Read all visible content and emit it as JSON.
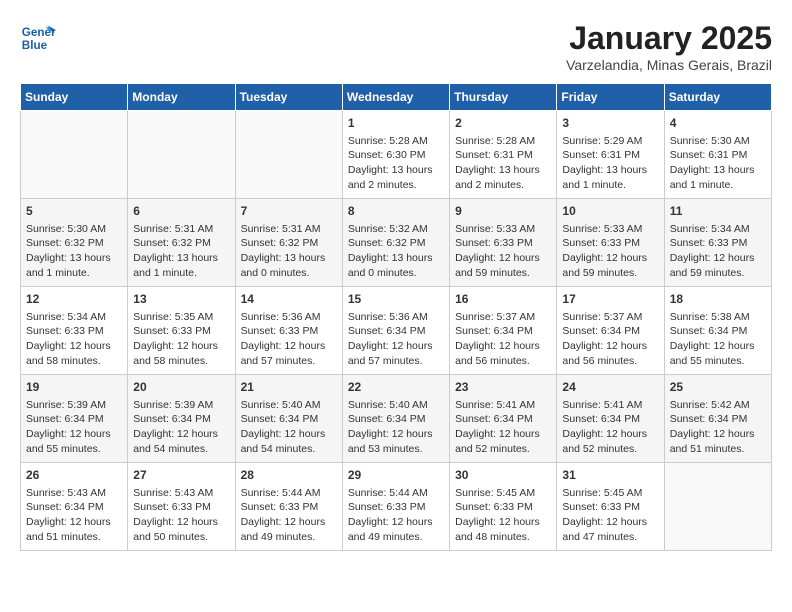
{
  "header": {
    "logo_line1": "General",
    "logo_line2": "Blue",
    "title": "January 2025",
    "subtitle": "Varzelandia, Minas Gerais, Brazil"
  },
  "calendar": {
    "days_of_week": [
      "Sunday",
      "Monday",
      "Tuesday",
      "Wednesday",
      "Thursday",
      "Friday",
      "Saturday"
    ],
    "weeks": [
      [
        {
          "day": "",
          "content": ""
        },
        {
          "day": "",
          "content": ""
        },
        {
          "day": "",
          "content": ""
        },
        {
          "day": "1",
          "content": "Sunrise: 5:28 AM\nSunset: 6:30 PM\nDaylight: 13 hours and 2 minutes."
        },
        {
          "day": "2",
          "content": "Sunrise: 5:28 AM\nSunset: 6:31 PM\nDaylight: 13 hours and 2 minutes."
        },
        {
          "day": "3",
          "content": "Sunrise: 5:29 AM\nSunset: 6:31 PM\nDaylight: 13 hours and 1 minute."
        },
        {
          "day": "4",
          "content": "Sunrise: 5:30 AM\nSunset: 6:31 PM\nDaylight: 13 hours and 1 minute."
        }
      ],
      [
        {
          "day": "5",
          "content": "Sunrise: 5:30 AM\nSunset: 6:32 PM\nDaylight: 13 hours and 1 minute."
        },
        {
          "day": "6",
          "content": "Sunrise: 5:31 AM\nSunset: 6:32 PM\nDaylight: 13 hours and 1 minute."
        },
        {
          "day": "7",
          "content": "Sunrise: 5:31 AM\nSunset: 6:32 PM\nDaylight: 13 hours and 0 minutes."
        },
        {
          "day": "8",
          "content": "Sunrise: 5:32 AM\nSunset: 6:32 PM\nDaylight: 13 hours and 0 minutes."
        },
        {
          "day": "9",
          "content": "Sunrise: 5:33 AM\nSunset: 6:33 PM\nDaylight: 12 hours and 59 minutes."
        },
        {
          "day": "10",
          "content": "Sunrise: 5:33 AM\nSunset: 6:33 PM\nDaylight: 12 hours and 59 minutes."
        },
        {
          "day": "11",
          "content": "Sunrise: 5:34 AM\nSunset: 6:33 PM\nDaylight: 12 hours and 59 minutes."
        }
      ],
      [
        {
          "day": "12",
          "content": "Sunrise: 5:34 AM\nSunset: 6:33 PM\nDaylight: 12 hours and 58 minutes."
        },
        {
          "day": "13",
          "content": "Sunrise: 5:35 AM\nSunset: 6:33 PM\nDaylight: 12 hours and 58 minutes."
        },
        {
          "day": "14",
          "content": "Sunrise: 5:36 AM\nSunset: 6:33 PM\nDaylight: 12 hours and 57 minutes."
        },
        {
          "day": "15",
          "content": "Sunrise: 5:36 AM\nSunset: 6:34 PM\nDaylight: 12 hours and 57 minutes."
        },
        {
          "day": "16",
          "content": "Sunrise: 5:37 AM\nSunset: 6:34 PM\nDaylight: 12 hours and 56 minutes."
        },
        {
          "day": "17",
          "content": "Sunrise: 5:37 AM\nSunset: 6:34 PM\nDaylight: 12 hours and 56 minutes."
        },
        {
          "day": "18",
          "content": "Sunrise: 5:38 AM\nSunset: 6:34 PM\nDaylight: 12 hours and 55 minutes."
        }
      ],
      [
        {
          "day": "19",
          "content": "Sunrise: 5:39 AM\nSunset: 6:34 PM\nDaylight: 12 hours and 55 minutes."
        },
        {
          "day": "20",
          "content": "Sunrise: 5:39 AM\nSunset: 6:34 PM\nDaylight: 12 hours and 54 minutes."
        },
        {
          "day": "21",
          "content": "Sunrise: 5:40 AM\nSunset: 6:34 PM\nDaylight: 12 hours and 54 minutes."
        },
        {
          "day": "22",
          "content": "Sunrise: 5:40 AM\nSunset: 6:34 PM\nDaylight: 12 hours and 53 minutes."
        },
        {
          "day": "23",
          "content": "Sunrise: 5:41 AM\nSunset: 6:34 PM\nDaylight: 12 hours and 52 minutes."
        },
        {
          "day": "24",
          "content": "Sunrise: 5:41 AM\nSunset: 6:34 PM\nDaylight: 12 hours and 52 minutes."
        },
        {
          "day": "25",
          "content": "Sunrise: 5:42 AM\nSunset: 6:34 PM\nDaylight: 12 hours and 51 minutes."
        }
      ],
      [
        {
          "day": "26",
          "content": "Sunrise: 5:43 AM\nSunset: 6:34 PM\nDaylight: 12 hours and 51 minutes."
        },
        {
          "day": "27",
          "content": "Sunrise: 5:43 AM\nSunset: 6:33 PM\nDaylight: 12 hours and 50 minutes."
        },
        {
          "day": "28",
          "content": "Sunrise: 5:44 AM\nSunset: 6:33 PM\nDaylight: 12 hours and 49 minutes."
        },
        {
          "day": "29",
          "content": "Sunrise: 5:44 AM\nSunset: 6:33 PM\nDaylight: 12 hours and 49 minutes."
        },
        {
          "day": "30",
          "content": "Sunrise: 5:45 AM\nSunset: 6:33 PM\nDaylight: 12 hours and 48 minutes."
        },
        {
          "day": "31",
          "content": "Sunrise: 5:45 AM\nSunset: 6:33 PM\nDaylight: 12 hours and 47 minutes."
        },
        {
          "day": "",
          "content": ""
        }
      ]
    ]
  }
}
